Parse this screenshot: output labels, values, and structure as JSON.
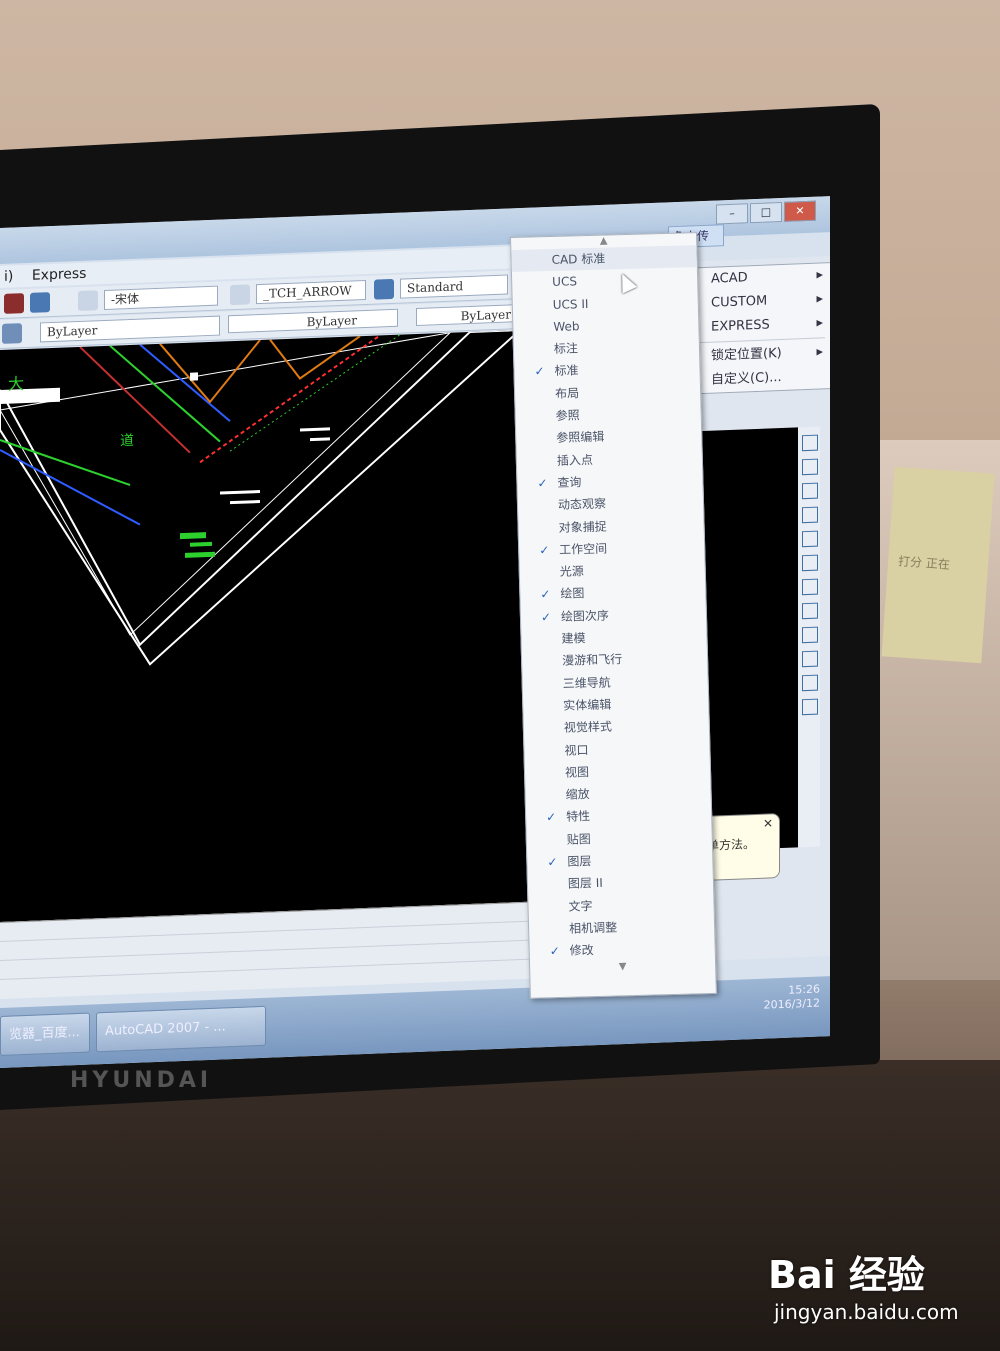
{
  "window": {
    "menubar": [
      "i)",
      "Express"
    ],
    "toolbar_row1": {
      "font_style_value": "-宋体",
      "dim_style_value": "_TCH_ARROW",
      "table_style_value": "Standard"
    },
    "toolbar_row2": {
      "layer_value": "ByLayer",
      "linetype_value": "ByLayer",
      "lineweight_value": "ByLayer"
    },
    "top_right_button": "免上传",
    "drawing_labels": [
      "大",
      "道"
    ]
  },
  "toolbar_menu": {
    "items": [
      {
        "label": "CAD 标准",
        "checked": false
      },
      {
        "label": "UCS",
        "checked": false
      },
      {
        "label": "UCS II",
        "checked": false
      },
      {
        "label": "Web",
        "checked": false
      },
      {
        "label": "标注",
        "checked": false
      },
      {
        "label": "标准",
        "checked": true
      },
      {
        "label": "布局",
        "checked": false
      },
      {
        "label": "参照",
        "checked": false
      },
      {
        "label": "参照编辑",
        "checked": false
      },
      {
        "label": "插入点",
        "checked": false
      },
      {
        "label": "查询",
        "checked": true
      },
      {
        "label": "动态观察",
        "checked": false
      },
      {
        "label": "对象捕捉",
        "checked": false
      },
      {
        "label": "工作空间",
        "checked": true
      },
      {
        "label": "光源",
        "checked": false
      },
      {
        "label": "绘图",
        "checked": true
      },
      {
        "label": "绘图次序",
        "checked": true
      },
      {
        "label": "建模",
        "checked": false
      },
      {
        "label": "漫游和飞行",
        "checked": false
      },
      {
        "label": "三维导航",
        "checked": false
      },
      {
        "label": "实体编辑",
        "checked": false
      },
      {
        "label": "视觉样式",
        "checked": false
      },
      {
        "label": "视口",
        "checked": false
      },
      {
        "label": "视图",
        "checked": false
      },
      {
        "label": "缩放",
        "checked": false
      },
      {
        "label": "特性",
        "checked": true
      },
      {
        "label": "贴图",
        "checked": false
      },
      {
        "label": "图层",
        "checked": true
      },
      {
        "label": "图层 II",
        "checked": false
      },
      {
        "label": "文字",
        "checked": false
      },
      {
        "label": "相机调整",
        "checked": false
      },
      {
        "label": "修改",
        "checked": true
      }
    ]
  },
  "context_menu": {
    "items": [
      {
        "label": "ACAD",
        "submenu": true
      },
      {
        "label": "CUSTOM",
        "submenu": true
      },
      {
        "label": "EXPRESS",
        "submenu": true
      },
      {
        "label": "锁定位置(K)",
        "submenu": true
      },
      {
        "label": "自定义(C)...",
        "submenu": false
      }
    ]
  },
  "tooltip": {
    "text": "简单方法。"
  },
  "taskbar": {
    "buttons": [
      "览器_百度...",
      "AutoCAD 2007 - ..."
    ],
    "clock_time": "15:26",
    "clock_date": "2016/3/12"
  },
  "monitor_brand": "HYUNDAI",
  "wall_note": "打分 正在",
  "watermark": {
    "logo": "Bai 经验",
    "url": "jingyan.baidu.com"
  }
}
